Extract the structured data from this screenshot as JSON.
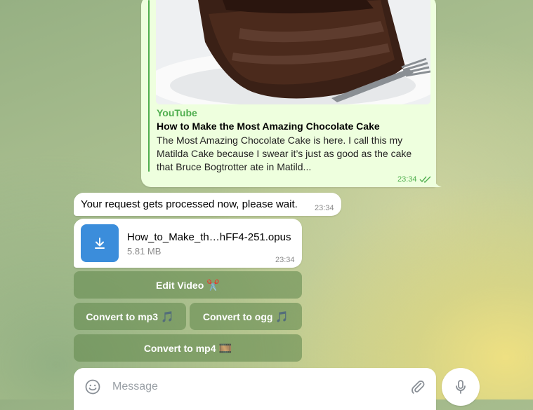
{
  "link_preview": {
    "site": "YouTube",
    "title": "How to Make the Most Amazing Chocolate Cake",
    "description": "The Most Amazing Chocolate Cake is here. I call this my Matilda Cake because I swear it’s just as good as the cake that Bruce Bogtrotter ate in Matild...",
    "time": "23:34",
    "image_icon": "chocolate-cake-thumbnail"
  },
  "messages": {
    "status_text": "Your request gets processed now, please wait.",
    "status_time": "23:34",
    "file": {
      "name": "How_to_Make_th…hFF4-251.opus",
      "size": "5.81 MB",
      "time": "23:34",
      "icon": "download-icon"
    }
  },
  "keyboard": {
    "edit_video": "Edit Video",
    "edit_video_emoji": "✂️",
    "mp3": "Convert to mp3",
    "mp3_emoji": "🎵",
    "ogg": "Convert to ogg",
    "ogg_emoji": "🎵",
    "mp4": "Convert to mp4",
    "mp4_emoji": "🎞️"
  },
  "composer": {
    "placeholder": "Message",
    "value": "",
    "emoji_icon": "smile-icon",
    "attach_icon": "paperclip-icon",
    "mic_icon": "microphone-icon"
  },
  "colors": {
    "outgoing_bubble": "#eeffde",
    "accent_green": "#4fae4e",
    "download_blue": "#3b8ddb",
    "keyboard_button": "#688c52"
  }
}
